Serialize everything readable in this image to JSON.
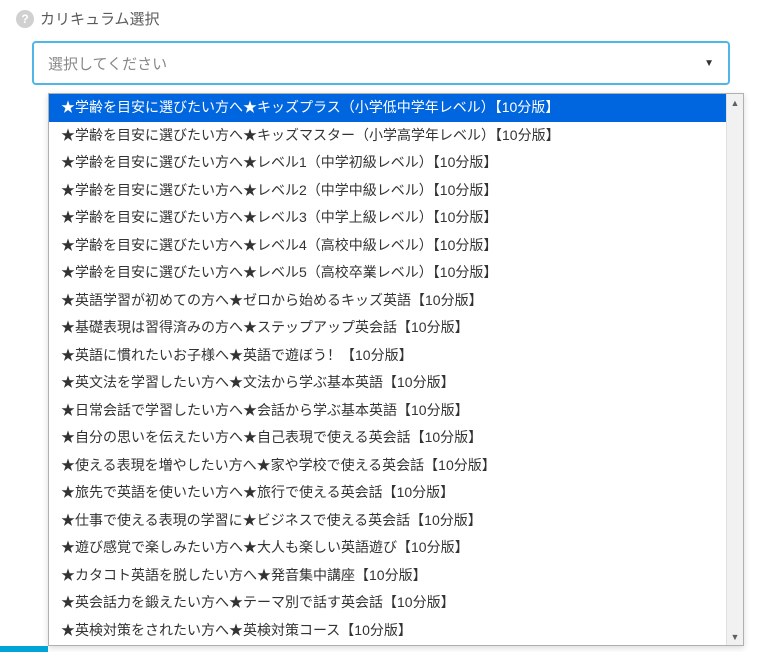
{
  "header": {
    "title": "カリキュラム選択"
  },
  "select": {
    "placeholder": "選択してください"
  },
  "options": [
    "★学齢を目安に選びたい方へ★キッズプラス（小学低中学年レベル）【10分版】",
    "★学齢を目安に選びたい方へ★キッズマスター（小学高学年レベル）【10分版】",
    "★学齢を目安に選びたい方へ★レベル1（中学初級レベル）【10分版】",
    "★学齢を目安に選びたい方へ★レベル2（中学中級レベル）【10分版】",
    "★学齢を目安に選びたい方へ★レベル3（中学上級レベル）【10分版】",
    "★学齢を目安に選びたい方へ★レベル4（高校中級レベル）【10分版】",
    "★学齢を目安に選びたい方へ★レベル5（高校卒業レベル）【10分版】",
    "★英語学習が初めての方へ★ゼロから始めるキッズ英語【10分版】",
    "★基礎表現は習得済みの方へ★ステップアップ英会話【10分版】",
    "★英語に慣れたいお子様へ★英語で遊ぼう！【10分版】",
    "★英文法を学習したい方へ★文法から学ぶ基本英語【10分版】",
    "★日常会話で学習したい方へ★会話から学ぶ基本英語【10分版】",
    "★自分の思いを伝えたい方へ★自己表現で使える英会話【10分版】",
    "★使える表現を増やしたい方へ★家や学校で使える英会話【10分版】",
    "★旅先で英語を使いたい方へ★旅行で使える英会話【10分版】",
    "★仕事で使える表現の学習に★ビジネスで使える英会話【10分版】",
    "★遊び感覚で楽しみたい方へ★大人も楽しい英語遊び【10分版】",
    "★カタコト英語を脱したい方へ★発音集中講座【10分版】",
    "★英会話力を鍛えたい方へ★テーマ別で話す英会話【10分版】",
    "★英検対策をされたい方へ★英検対策コース【10分版】"
  ],
  "highlighted_index": 0
}
